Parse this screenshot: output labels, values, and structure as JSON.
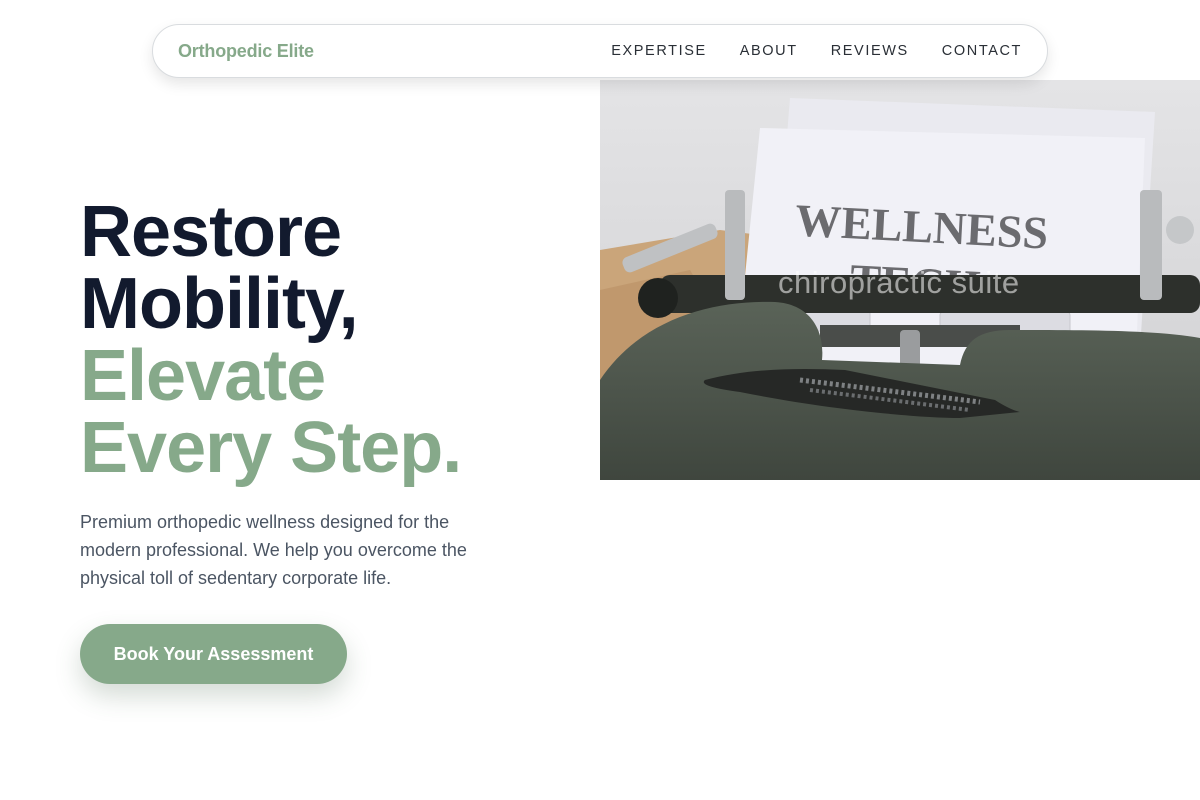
{
  "nav": {
    "brand": "Orthopedic Elite",
    "links": [
      {
        "label": "EXPERTISE"
      },
      {
        "label": "ABOUT"
      },
      {
        "label": "REVIEWS"
      },
      {
        "label": "CONTACT"
      }
    ]
  },
  "hero": {
    "headline_line1": "Restore",
    "headline_line2": "Mobility,",
    "headline_line3": "Elevate",
    "headline_line4": "Every Step.",
    "description": "Premium orthopedic wellness designed for the modern professional. We help you overcome the physical toll of sedentary corporate life.",
    "cta_label": "Book Your Assessment",
    "image": {
      "paper_text_line1": "WELLNESS",
      "paper_text_line2": "TECH",
      "watermark": "chiropractic suite"
    }
  },
  "colors": {
    "accent": "#86a98a",
    "heading": "#121a2e",
    "body_text": "#4b5563",
    "typewriter": "#4a5249"
  }
}
